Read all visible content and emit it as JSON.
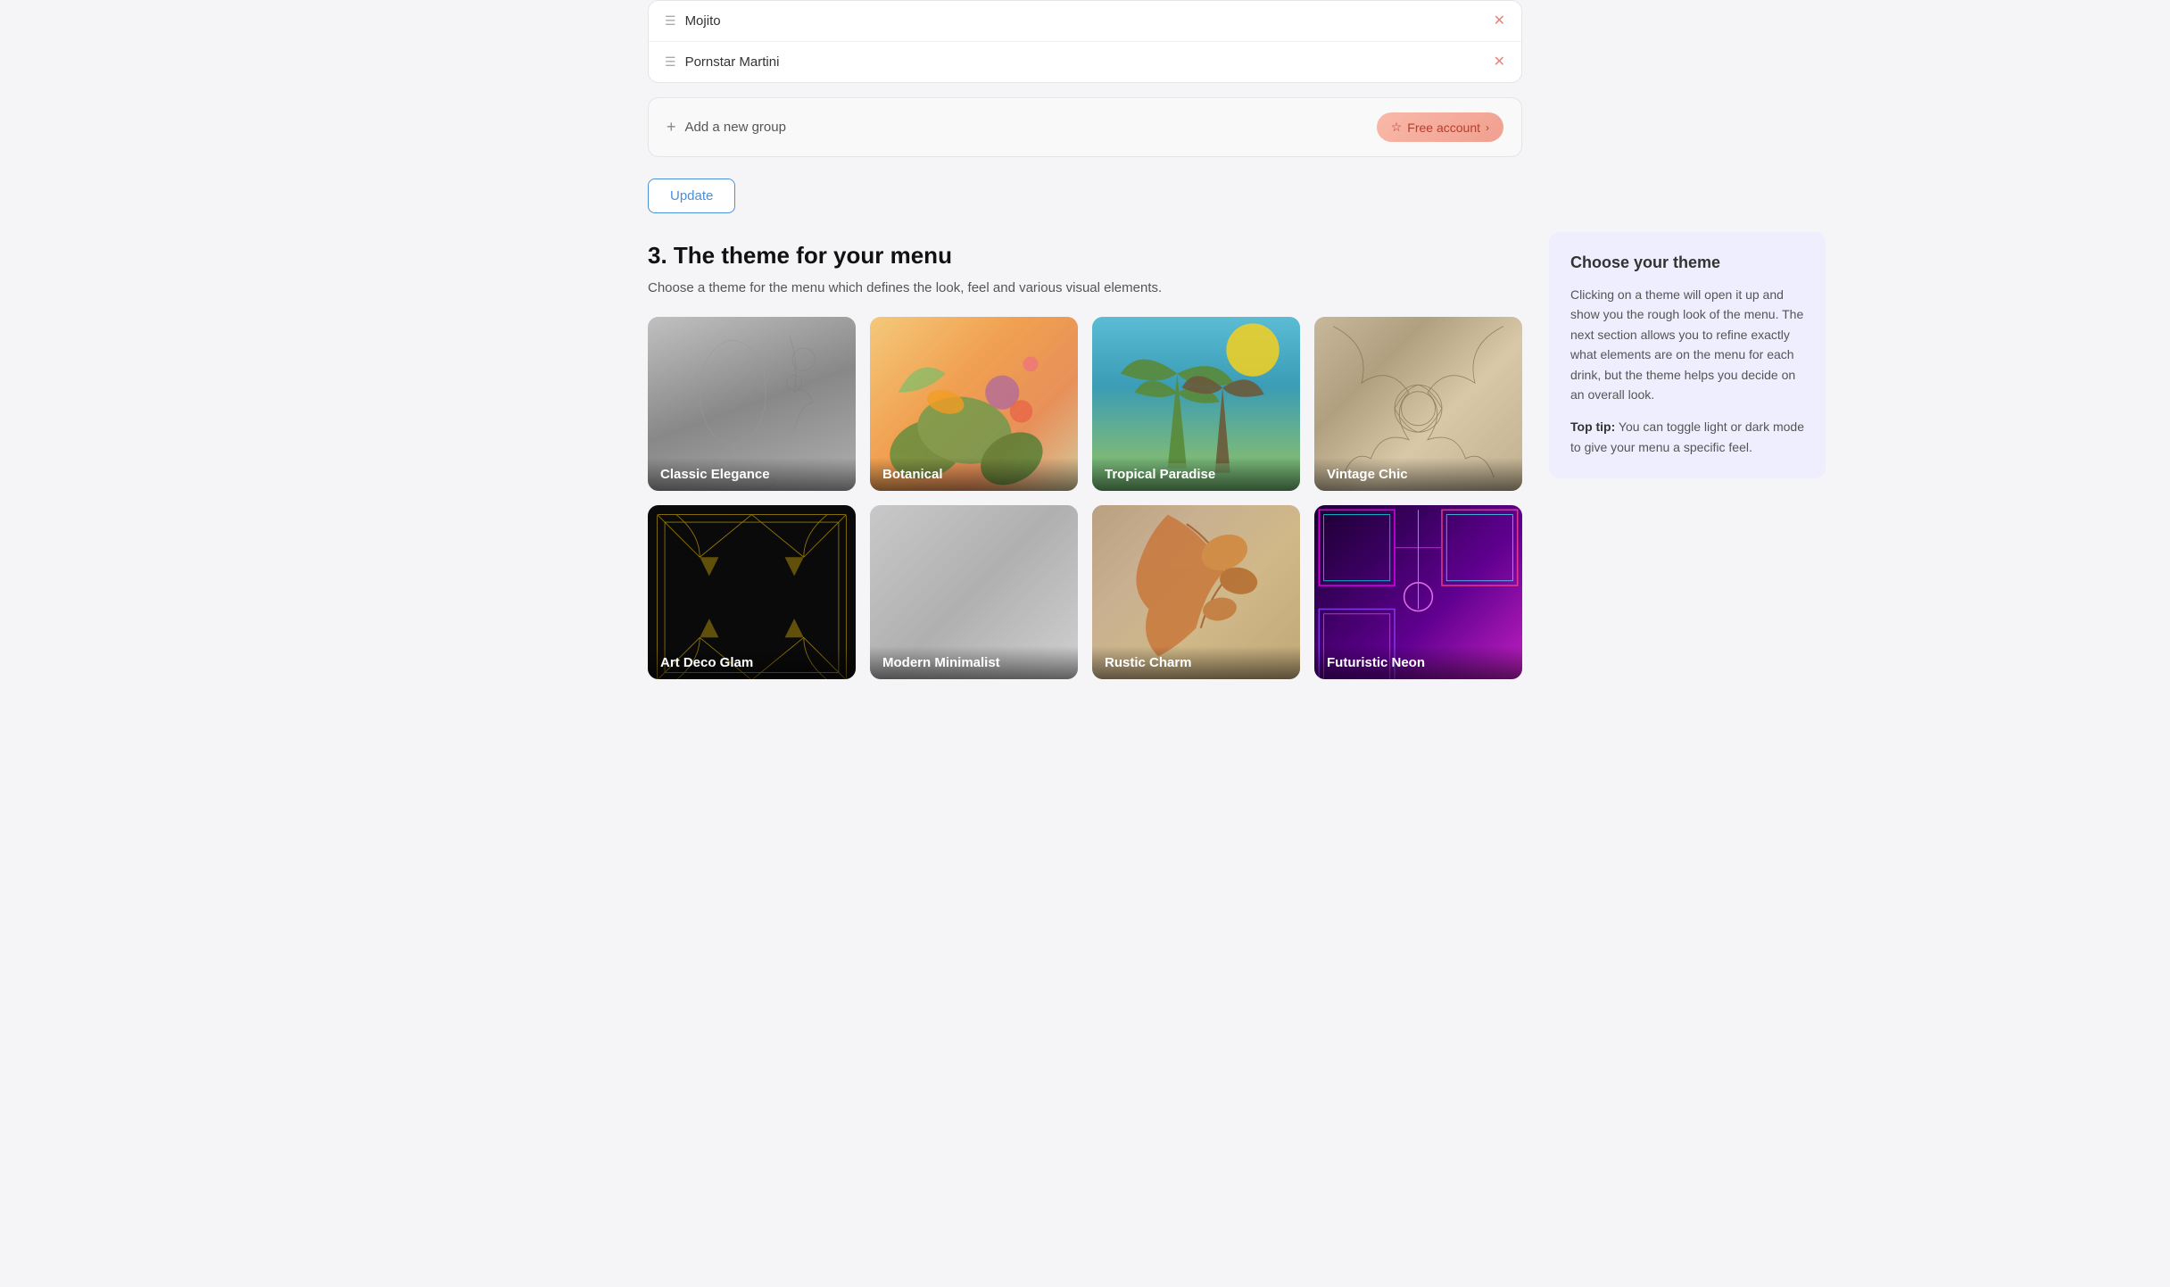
{
  "drinks": [
    {
      "name": "Mojito"
    },
    {
      "name": "Pornstar Martini"
    }
  ],
  "add_group": {
    "label": "Add a new group",
    "badge_label": "Free account"
  },
  "update_button": "Update",
  "section": {
    "heading": "3. The theme for your menu",
    "subtext": "Choose a theme for the menu which defines the look, feel and various visual elements."
  },
  "themes": [
    {
      "id": "classic-elegance",
      "label": "Classic Elegance",
      "style": "classic"
    },
    {
      "id": "botanical",
      "label": "Botanical",
      "style": "botanical"
    },
    {
      "id": "tropical-paradise",
      "label": "Tropical Paradise",
      "style": "tropical"
    },
    {
      "id": "vintage-chic",
      "label": "Vintage Chic",
      "style": "vintage"
    },
    {
      "id": "art-deco-glam",
      "label": "Art Deco Glam",
      "style": "artdeco"
    },
    {
      "id": "modern-minimalist",
      "label": "Modern Minimalist",
      "style": "modern"
    },
    {
      "id": "rustic-charm",
      "label": "Rustic Charm",
      "style": "rustic"
    },
    {
      "id": "futuristic-neon",
      "label": "Futuristic Neon",
      "style": "futuristic"
    }
  ],
  "tooltip": {
    "title": "Choose your theme",
    "body": "Clicking on a theme will open it up and show you the rough look of the menu. The next section allows you to refine exactly what elements are on the menu for each drink, but the theme helps you decide on an overall look.",
    "tip_label": "Top tip:",
    "tip_text": " You can toggle light or dark mode to give your menu a specific feel."
  }
}
